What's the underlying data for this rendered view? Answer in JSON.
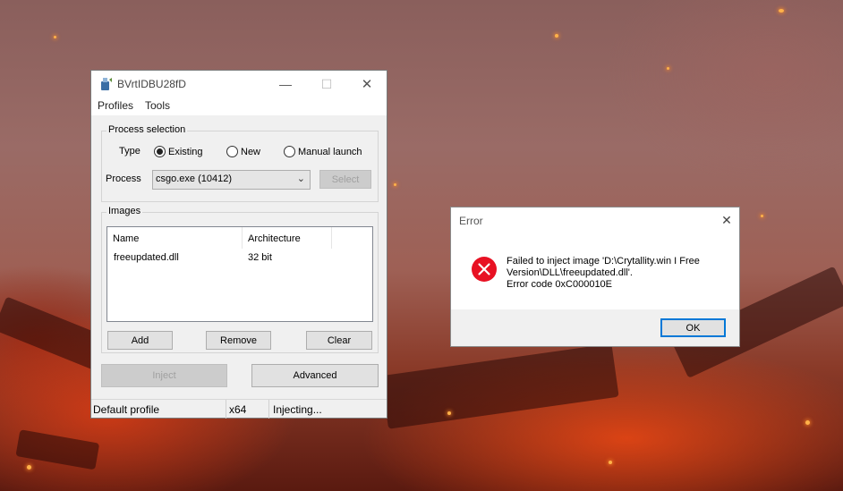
{
  "main_window": {
    "title": "BVrtIDBU28fD",
    "controls": {
      "minimize": "—",
      "maximize": "☐",
      "close": "✕"
    },
    "menu": [
      "Profiles",
      "Tools"
    ],
    "process_selection": {
      "label": "Process selection",
      "type_label": "Type",
      "type_options": [
        {
          "label": "Existing",
          "selected": true
        },
        {
          "label": "New",
          "selected": false
        },
        {
          "label": "Manual launch",
          "selected": false
        }
      ],
      "process_label": "Process",
      "process_value": "csgo.exe (10412)",
      "select_button": "Select"
    },
    "images": {
      "label": "Images",
      "columns": [
        "Name",
        "Architecture"
      ],
      "rows": [
        {
          "name": "freeupdated.dll",
          "arch": "32 bit"
        }
      ],
      "add_button": "Add",
      "remove_button": "Remove",
      "clear_button": "Clear"
    },
    "inject_button": "Inject",
    "advanced_button": "Advanced",
    "status": {
      "profile": "Default profile",
      "arch": "x64",
      "state": "Injecting..."
    }
  },
  "error_dialog": {
    "title": "Error",
    "close": "✕",
    "message_lines": [
      "Failed to inject image 'D:\\Crytallity.win I Free",
      "Version\\DLL\\freeupdated.dll'.",
      "Error code 0xC000010E"
    ],
    "ok_button": "OK"
  },
  "colors": {
    "error_red": "#e81123",
    "accent": "#0078d7"
  }
}
